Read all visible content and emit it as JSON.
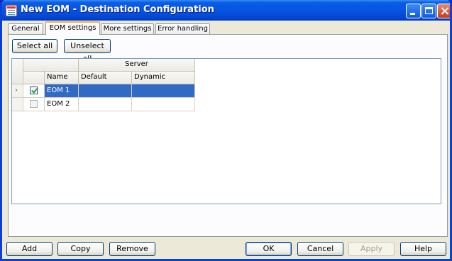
{
  "window": {
    "title": "New EOM - Destination Configuration"
  },
  "tabs": [
    {
      "label": "General"
    },
    {
      "label": "EOM settings"
    },
    {
      "label": "More settings"
    },
    {
      "label": "Error handling"
    }
  ],
  "active_tab": "EOM settings",
  "toolbar": {
    "select_all": "Select all",
    "unselect_all": "Unselect all"
  },
  "grid": {
    "group_header": "Server",
    "columns": [
      "Name",
      "Default",
      "Dynamic"
    ],
    "rows": [
      {
        "checked": true,
        "name": "EOM 1",
        "default": "",
        "dynamic": "",
        "selected": true
      },
      {
        "checked": false,
        "name": "EOM 2",
        "default": "",
        "dynamic": "",
        "selected": false
      }
    ]
  },
  "footer": {
    "add": "Add",
    "copy": "Copy",
    "remove": "Remove",
    "ok": "OK",
    "cancel": "Cancel",
    "apply": "Apply",
    "help": "Help"
  },
  "colors": {
    "title_bar": "#0654e0",
    "selection": "#316ac5",
    "tab_accent": "#f5b040"
  }
}
